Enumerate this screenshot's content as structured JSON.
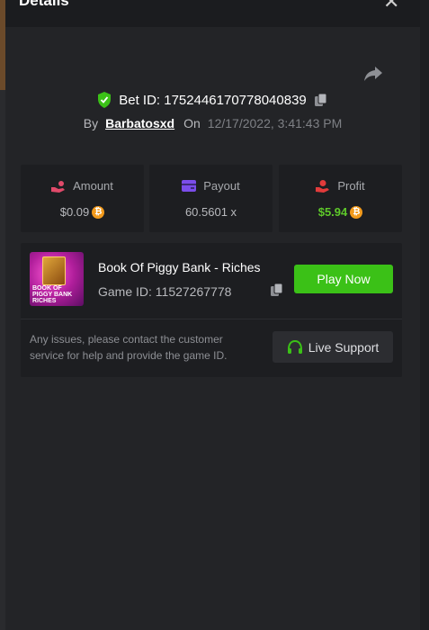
{
  "header": {
    "title": "Details",
    "close_icon": "close-icon"
  },
  "bet": {
    "label": "Bet ID: 1752446170778040839",
    "by_label": "By",
    "username": "Barbatosxd",
    "on_label": "On",
    "date": "12/17/2022, 3:41:43 PM",
    "share_icon": "share-icon",
    "verified_icon": "shield-check-icon",
    "copy_icon": "copy-icon"
  },
  "stats": [
    {
      "label": "Amount",
      "value": "$0.09",
      "icon": "hand-coins-icon",
      "coin": true
    },
    {
      "label": "Payout",
      "value": "60.5601 x",
      "icon": "wallet-icon",
      "coin": false
    },
    {
      "label": "Profit",
      "value": "$5.94",
      "icon": "hand-profit-icon",
      "coin": true
    }
  ],
  "game": {
    "title": "Book Of Piggy Bank - Riches",
    "id_label": "Game ID: 11527267778",
    "thumb_text": "BOOK OF PIGGY BANK RICHES",
    "play_label": "Play Now",
    "issues_text": "Any issues, please contact the customer service for help and provide the game ID.",
    "support_label": "Live Support"
  },
  "colors": {
    "accent_green": "#3bc117",
    "profit_green": "#5ec82a",
    "coin_orange": "#f29a1c",
    "amount_icon": "#e14a6a",
    "payout_icon": "#7b4dea",
    "profit_icon": "#e23b3b"
  }
}
